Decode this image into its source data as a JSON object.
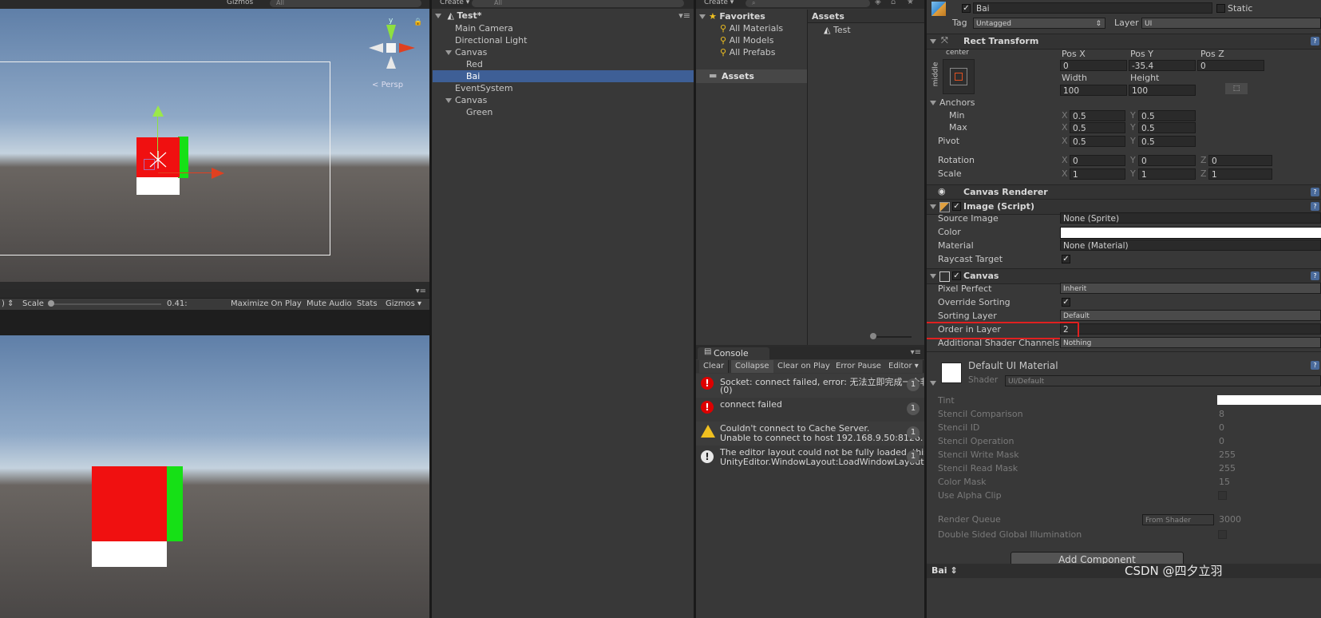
{
  "scene_view": {
    "gizmos_label": "Gizmos",
    "search_placeholder": "All",
    "persp_label": "Persp"
  },
  "game_view": {
    "scale_label": "Scale",
    "scale_value": "0.41:",
    "buttons": [
      "Maximize On Play",
      "Mute Audio",
      "Stats",
      "Gizmos"
    ]
  },
  "hierarchy": {
    "create_label": "Create",
    "search_placeholder": "All",
    "scene_name": "Test*",
    "items": [
      {
        "label": "Main Camera"
      },
      {
        "label": "Directional Light"
      },
      {
        "label": "Canvas"
      },
      {
        "label": "Red"
      },
      {
        "label": "Bai"
      },
      {
        "label": "EventSystem"
      },
      {
        "label": "Canvas"
      },
      {
        "label": "Green"
      }
    ]
  },
  "project": {
    "create_label": "Create",
    "favorites_label": "Favorites",
    "favorites": [
      "All Materials",
      "All Models",
      "All Prefabs"
    ],
    "assets_folder": "Assets",
    "assets_header": "Assets",
    "asset_items": [
      "Test"
    ]
  },
  "console": {
    "tab_label": "Console",
    "buttons": [
      "Clear",
      "Collapse",
      "Clear on Play",
      "Error Pause",
      "Editor"
    ],
    "messages": [
      {
        "type": "error",
        "line1": "Socket: connect failed, error: 无法立即完成一个非",
        "line2": "(0)",
        "count": "1"
      },
      {
        "type": "error",
        "line1": "connect failed",
        "line2": "",
        "count": "1"
      },
      {
        "type": "warning",
        "line1": "Couldn't connect to Cache Server.",
        "line2": "Unable to connect to host 192.168.9.50:8126.",
        "count": "1"
      },
      {
        "type": "info",
        "line1": "The editor layout could not be fully loaded, this",
        "line2": "UnityEditor.WindowLayout:LoadWindowLayout(S",
        "count": "1"
      }
    ]
  },
  "inspector": {
    "object_name": "Bai",
    "static_label": "Static",
    "tag_label": "Tag",
    "tag_value": "Untagged",
    "layer_label": "Layer",
    "layer_value": "UI",
    "rect_transform": {
      "title": "Rect Transform",
      "anchor_preset_top": "center",
      "anchor_preset_side": "middle",
      "pos_x_label": "Pos X",
      "pos_y_label": "Pos Y",
      "pos_z_label": "Pos Z",
      "pos_x": "0",
      "pos_y": "-35.4",
      "pos_z": "0",
      "width_label": "Width",
      "height_label": "Height",
      "width": "100",
      "height": "100",
      "anchors_label": "Anchors",
      "min_label": "Min",
      "max_label": "Max",
      "anchor_min_x": "0.5",
      "anchor_min_y": "0.5",
      "anchor_max_x": "0.5",
      "anchor_max_y": "0.5",
      "pivot_label": "Pivot",
      "pivot_x": "0.5",
      "pivot_y": "0.5",
      "rotation_label": "Rotation",
      "rot_x": "0",
      "rot_y": "0",
      "rot_z": "0",
      "scale_label": "Scale",
      "scale_x": "1",
      "scale_y": "1",
      "scale_z": "1",
      "x": "X",
      "y": "Y",
      "z": "Z"
    },
    "canvas_renderer": {
      "title": "Canvas Renderer"
    },
    "image_script": {
      "title": "Image (Script)",
      "source_image_label": "Source Image",
      "source_image": "None (Sprite)",
      "color_label": "Color",
      "material_label": "Material",
      "material": "None (Material)",
      "raycast_label": "Raycast Target"
    },
    "canvas": {
      "title": "Canvas",
      "pixel_perfect_label": "Pixel Perfect",
      "pixel_perfect": "Inherit",
      "override_sorting_label": "Override Sorting",
      "sorting_layer_label": "Sorting Layer",
      "sorting_layer": "Default",
      "order_label": "Order in Layer",
      "order_value": "2",
      "shader_channels_label": "Additional Shader Channels",
      "shader_channels": "Nothing"
    },
    "material": {
      "title": "Default UI Material",
      "shader_label": "Shader",
      "shader_value": "UI/Default",
      "tint_label": "Tint",
      "props": [
        {
          "label": "Stencil Comparison",
          "value": "8"
        },
        {
          "label": "Stencil ID",
          "value": "0"
        },
        {
          "label": "Stencil Operation",
          "value": "0"
        },
        {
          "label": "Stencil Write Mask",
          "value": "255"
        },
        {
          "label": "Stencil Read Mask",
          "value": "255"
        },
        {
          "label": "Color Mask",
          "value": "15"
        }
      ],
      "alpha_clip_label": "Use Alpha Clip",
      "render_queue_label": "Render Queue",
      "render_queue_mode": "From Shader",
      "render_queue_value": "3000",
      "double_sided_label": "Double Sided Global Illumination"
    },
    "add_component": "Add Component",
    "footer_label": "Bai"
  },
  "watermark": "CSDN @四夕立羽",
  "colors": {
    "selection": "#3e5f96",
    "highlight_box": "#e02020"
  }
}
